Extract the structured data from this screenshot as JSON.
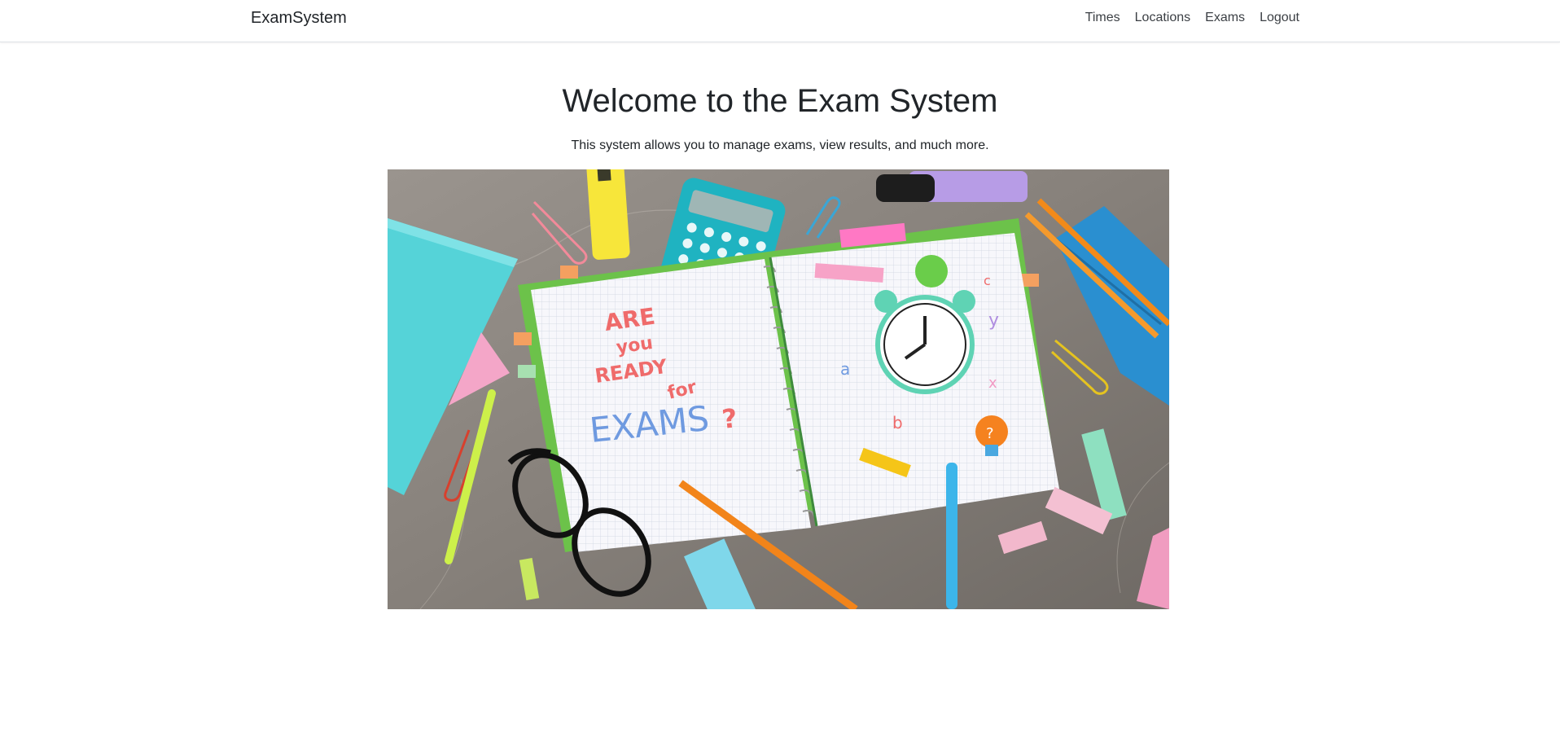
{
  "navbar": {
    "brand": "ExamSystem",
    "links": [
      "Times",
      "Locations",
      "Exams",
      "Logout"
    ]
  },
  "main": {
    "title": "Welcome to the Exam System",
    "subtitle": "This system allows you to manage exams, view results, and much more.",
    "hero_image": {
      "handwriting": [
        "ARE",
        "you",
        "READY",
        "for",
        "EXAMS",
        "?"
      ],
      "doodle_letters": [
        "c",
        "y",
        "a",
        "x",
        "b"
      ],
      "background_color": "#8a8580",
      "notebook_color": "#6cc24a"
    }
  }
}
